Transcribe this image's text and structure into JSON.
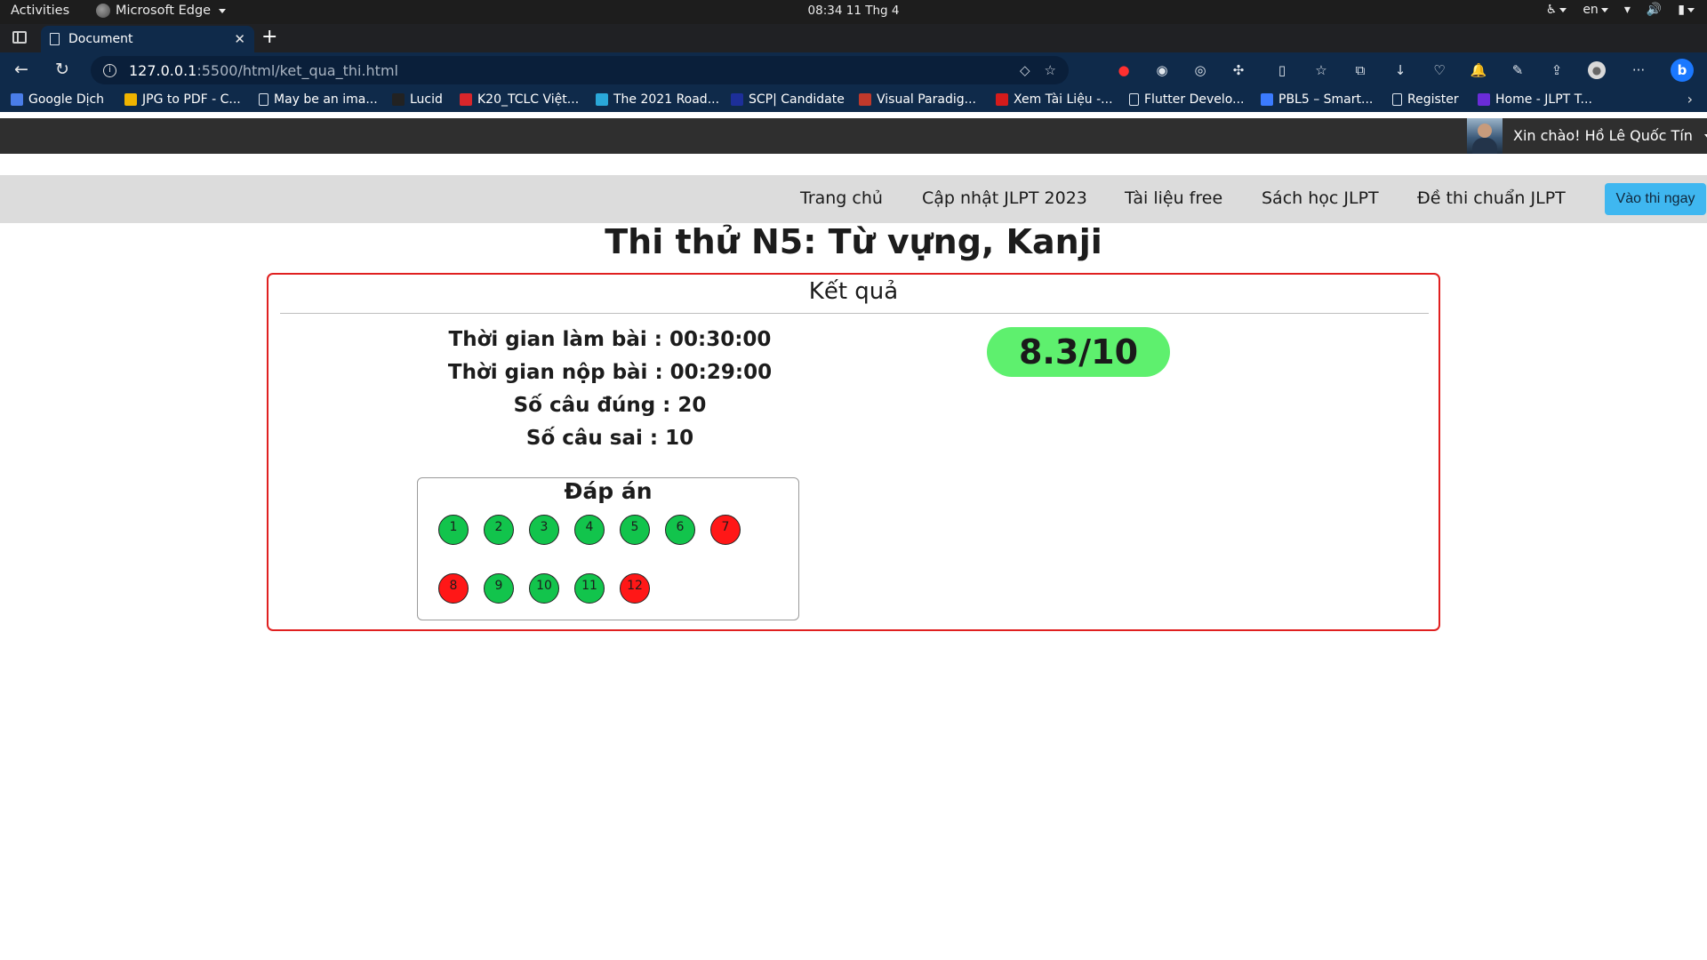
{
  "os": {
    "activities": "Activities",
    "app_name": "Microsoft Edge",
    "clock": "08:34  11 Thg 4",
    "lang": "en"
  },
  "browser": {
    "tab_title": "Document",
    "url_host": "127.0.0.1",
    "url_rest": ":5500/html/ket_qua_thi.html",
    "bookmarks": [
      {
        "label": "Google Dịch",
        "color": "#4a7de8"
      },
      {
        "label": "JPG to PDF - C...",
        "color": "#f0b400"
      },
      {
        "label": "May be an ima...",
        "color": ""
      },
      {
        "label": "Lucid",
        "color": "#222222"
      },
      {
        "label": "K20_TCLC Việt...",
        "color": "#d8262b"
      },
      {
        "label": "The 2021 Road...",
        "color": "#2aa7d8"
      },
      {
        "label": "SCP| Candidate",
        "color": "#1d2f9a"
      },
      {
        "label": "Visual Paradig...",
        "color": "#c0392b"
      },
      {
        "label": "Xem Tài Liệu -...",
        "color": "#d41b1b"
      },
      {
        "label": "Flutter Develo...",
        "color": ""
      },
      {
        "label": "PBL5 – Smart...",
        "color": "#3b7bff"
      },
      {
        "label": "Register",
        "color": ""
      },
      {
        "label": "Home - JLPT T...",
        "color": "#6a2cd8"
      }
    ]
  },
  "site": {
    "greeting": "Xin chào! Hồ Lê Quốc Tín",
    "nav": [
      "Trang chủ",
      "Cập nhật JLPT 2023",
      "Tài liệu free",
      "Sách học JLPT",
      "Đề thi chuẩn JLPT"
    ],
    "cta": "Vào thi ngay"
  },
  "page": {
    "title": "Thi thử N5: Từ vựng, Kanji",
    "card_title": "Kết quả",
    "stats": [
      "Thời gian làm bài : 00:30:00",
      "Thời gian nộp bài : 00:29:00",
      "Số câu đúng : 20",
      "Số câu sai : 10"
    ],
    "score": "8.3/10",
    "answers_title": "Đáp án",
    "answers": [
      {
        "n": "1",
        "status": "correct"
      },
      {
        "n": "2",
        "status": "correct"
      },
      {
        "n": "3",
        "status": "correct"
      },
      {
        "n": "4",
        "status": "correct"
      },
      {
        "n": "5",
        "status": "correct"
      },
      {
        "n": "6",
        "status": "correct"
      },
      {
        "n": "7",
        "status": "wrong"
      },
      {
        "n": "8",
        "status": "wrong"
      },
      {
        "n": "9",
        "status": "correct"
      },
      {
        "n": "10",
        "status": "correct"
      },
      {
        "n": "11",
        "status": "correct"
      },
      {
        "n": "12",
        "status": "wrong"
      }
    ]
  },
  "colors": {
    "correct": "#12c44c",
    "wrong": "#ff1717",
    "score_bg": "#5ef06e",
    "card_border": "#e02020",
    "cta_bg": "#3fb7f0"
  }
}
